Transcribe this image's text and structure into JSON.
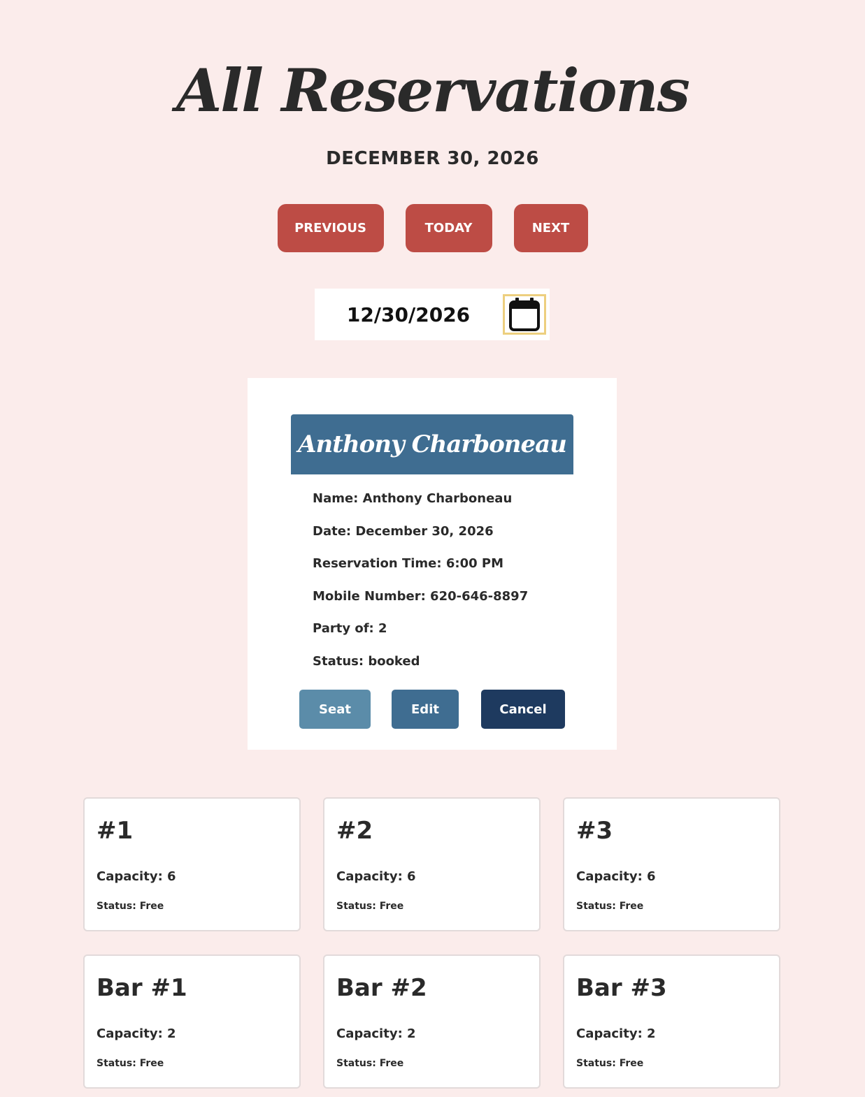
{
  "page": {
    "title": "All Reservations",
    "date_heading": "DECEMBER 30, 2026"
  },
  "nav": {
    "previous_label": "PREVIOUS",
    "today_label": "TODAY",
    "next_label": "NEXT"
  },
  "date_picker": {
    "value": "12/30/2026",
    "icon": "calendar-icon"
  },
  "reservation": {
    "header_name": "Anthony Charboneau",
    "details": [
      "Name: Anthony Charboneau",
      "Date: December 30, 2026",
      "Reservation Time: 6:00 PM",
      "Mobile Number: 620-646-8897",
      "Party of: 2",
      "Status: booked"
    ],
    "actions": {
      "seat_label": "Seat",
      "edit_label": "Edit",
      "cancel_label": "Cancel"
    }
  },
  "tables": [
    {
      "name": "#1",
      "capacity": "Capacity: 6",
      "status": "Status: Free"
    },
    {
      "name": "#2",
      "capacity": "Capacity: 6",
      "status": "Status: Free"
    },
    {
      "name": "#3",
      "capacity": "Capacity: 6",
      "status": "Status: Free"
    },
    {
      "name": "Bar #1",
      "capacity": "Capacity: 2",
      "status": "Status: Free"
    },
    {
      "name": "Bar #2",
      "capacity": "Capacity: 2",
      "status": "Status: Free"
    },
    {
      "name": "Bar #3",
      "capacity": "Capacity: 2",
      "status": "Status: Free"
    }
  ],
  "colors": {
    "background": "#fbeceb",
    "nav_button": "#bd4c45",
    "card_header": "#3f6d91",
    "seat_button": "#5b8ca9",
    "edit_button": "#3f6d91",
    "cancel_button": "#1e3a5f",
    "calendar_border": "#edcf7f"
  }
}
